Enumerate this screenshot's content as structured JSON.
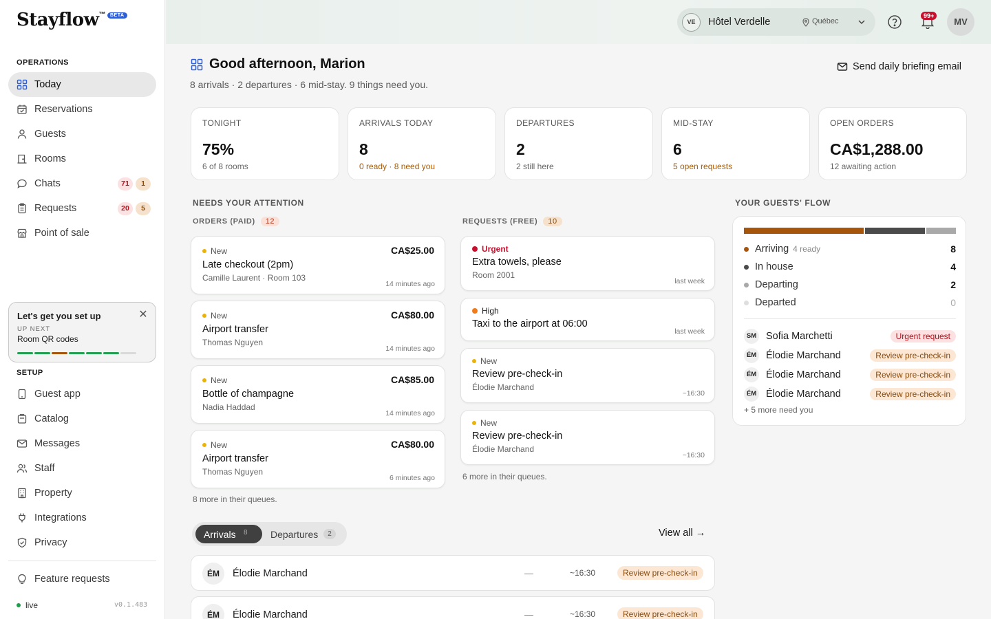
{
  "app": {
    "name": "Stayflow",
    "tm": "™",
    "badge": "BETA"
  },
  "sidebar": {
    "operations_label": "OPERATIONS",
    "operations": [
      {
        "label": "Today",
        "icon": "dashboard-icon",
        "active": true
      },
      {
        "label": "Reservations",
        "icon": "calendar-icon"
      },
      {
        "label": "Guests",
        "icon": "user-icon"
      },
      {
        "label": "Rooms",
        "icon": "bed-icon"
      },
      {
        "label": "Chats",
        "icon": "chat-icon",
        "badge_red": "71",
        "badge_tan": "1"
      },
      {
        "label": "Requests",
        "icon": "clipboard-icon",
        "badge_red": "20",
        "badge_tan": "5"
      },
      {
        "label": "Point of sale",
        "icon": "store-icon"
      }
    ],
    "setup_card": {
      "title": "Let's get you set up",
      "up_next_label": "UP NEXT",
      "up_next": "Room QR codes",
      "close": "✕"
    },
    "setup_label": "SETUP",
    "setup": [
      {
        "label": "Guest app",
        "icon": "phone-icon"
      },
      {
        "label": "Catalog",
        "icon": "catalog-icon"
      },
      {
        "label": "Messages",
        "icon": "mail-icon"
      },
      {
        "label": "Staff",
        "icon": "staff-icon"
      },
      {
        "label": "Property",
        "icon": "building-icon"
      },
      {
        "label": "Integrations",
        "icon": "plug-icon"
      },
      {
        "label": "Privacy",
        "icon": "shield-icon"
      }
    ],
    "feature_requests": "Feature requests",
    "status": "live",
    "version": "v0.1.483"
  },
  "topbar": {
    "hotel_initials": "VE",
    "hotel_name": "Hôtel Verdelle",
    "hotel_location": "Québec",
    "notif_badge": "99+",
    "user_initials": "MV"
  },
  "header": {
    "greeting": "Good afternoon, Marion",
    "summary": "8 arrivals · 2 departures · 6 mid-stay. 9 things need you.",
    "briefing_button": "Send daily briefing email"
  },
  "stats": [
    {
      "label": "TONIGHT",
      "value": "75%",
      "sub": "6 of 8 rooms",
      "warn": false
    },
    {
      "label": "ARRIVALS TODAY",
      "value": "8",
      "sub": "0 ready · 8 need you",
      "warn": true
    },
    {
      "label": "DEPARTURES",
      "value": "2",
      "sub": "2 still here",
      "warn": false
    },
    {
      "label": "MID-STAY",
      "value": "6",
      "sub": "5 open requests",
      "warn": true
    },
    {
      "label": "OPEN ORDERS",
      "value": "CA$1,288.00",
      "sub": "12 awaiting action",
      "warn": false
    }
  ],
  "attention": {
    "title": "NEEDS YOUR ATTENTION",
    "orders_label": "ORDERS (PAID)",
    "orders_count": "12",
    "orders": [
      {
        "status": "New",
        "title": "Late checkout (2pm)",
        "meta": "Camille Laurent · Room 103",
        "price": "CA$25.00",
        "ago": "14 minutes ago"
      },
      {
        "status": "New",
        "title": "Airport transfer",
        "meta": "Thomas Nguyen",
        "price": "CA$80.00",
        "ago": "14 minutes ago"
      },
      {
        "status": "New",
        "title": "Bottle of champagne",
        "meta": "Nadia Haddad",
        "price": "CA$85.00",
        "ago": "14 minutes ago"
      },
      {
        "status": "New",
        "title": "Airport transfer",
        "meta": "Thomas Nguyen",
        "price": "CA$80.00",
        "ago": "6 minutes ago"
      }
    ],
    "orders_more": "8 more in their queues.",
    "requests_label": "REQUESTS (FREE)",
    "requests_count": "10",
    "requests": [
      {
        "status": "Urgent",
        "title": "Extra towels, please",
        "meta": "Room 2001",
        "ago": "last week"
      },
      {
        "status": "High",
        "title": "Taxi to the airport at 06:00",
        "meta": "",
        "ago": "last week"
      },
      {
        "status": "New",
        "title": "Review pre-check-in",
        "meta": "Élodie Marchand",
        "ago": "~16:30"
      },
      {
        "status": "New",
        "title": "Review pre-check-in",
        "meta": "Élodie Marchand",
        "ago": "~16:30"
      }
    ],
    "requests_more": "6 more in their queues."
  },
  "flow": {
    "title": "YOUR GUESTS' FLOW",
    "colors": {
      "arriving": "#a5560c",
      "in_house": "#4a4b4a",
      "departing": "#a9a9a9",
      "departed": "#dedede"
    },
    "rows": [
      {
        "label": "Arriving",
        "sub": "4 ready",
        "value": "8",
        "key": "arriving"
      },
      {
        "label": "In house",
        "sub": "",
        "value": "4",
        "key": "in_house"
      },
      {
        "label": "Departing",
        "sub": "",
        "value": "2",
        "key": "departing"
      },
      {
        "label": "Departed",
        "sub": "",
        "value": "0",
        "key": "departed"
      }
    ],
    "guests": [
      {
        "initials": "SM",
        "name": "Sofia Marchetti",
        "tag": "Urgent request",
        "urgent": true
      },
      {
        "initials": "ÉM",
        "name": "Élodie Marchand",
        "tag": "Review pre-check-in",
        "urgent": false
      },
      {
        "initials": "ÉM",
        "name": "Élodie Marchand",
        "tag": "Review pre-check-in",
        "urgent": false
      },
      {
        "initials": "ÉM",
        "name": "Élodie Marchand",
        "tag": "Review pre-check-in",
        "urgent": false
      }
    ],
    "more": "+ 5 more need you"
  },
  "movements": {
    "tab_arrivals": "Arrivals",
    "tab_arrivals_count": "8",
    "tab_departures": "Departures",
    "tab_departures_count": "2",
    "view_all": "View all →",
    "rows": [
      {
        "initials": "ÉM",
        "name": "Élodie Marchand",
        "room": "—",
        "time": "~16:30",
        "tag": "Review pre-check-in"
      },
      {
        "initials": "ÉM",
        "name": "Élodie Marchand",
        "room": "—",
        "time": "~16:30",
        "tag": "Review pre-check-in"
      }
    ]
  },
  "colors": {
    "accent": "#2f5fd8",
    "urgent": "#c8102e",
    "warn": "#a55a08"
  }
}
